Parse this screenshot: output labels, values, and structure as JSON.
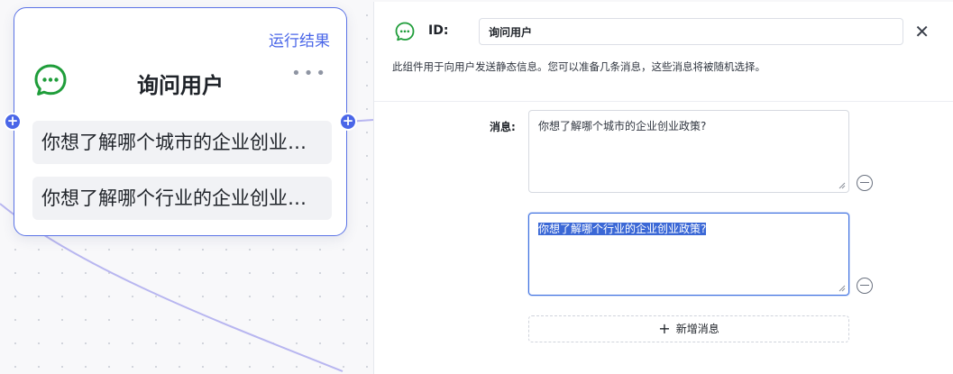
{
  "canvas": {
    "node": {
      "run_result_label": "运行结果",
      "title": "询问用户",
      "more_label": "•••",
      "messages": [
        "你想了解哪个城市的企业创业政策?",
        "你想了解哪个行业的企业创业政策?"
      ],
      "port_symbol": "+"
    },
    "colors": {
      "accent": "#4a66e8",
      "icon_green": "#1f9d3a",
      "edge": "#b8b6f0"
    }
  },
  "panel": {
    "icon": "chat-bubble-icon",
    "id_label": "ID:",
    "id_value": "询问用户",
    "close_symbol": "✕",
    "description": "此组件用于向用户发送静态信息。您可以准备几条消息，这些消息将被随机选择。",
    "messages_label": "消息:",
    "messages": [
      "你想了解哪个城市的企业创业政策?",
      "你想了解哪个行业的企业创业政策?"
    ],
    "add_plus": "+",
    "add_message_label": "新增消息"
  }
}
